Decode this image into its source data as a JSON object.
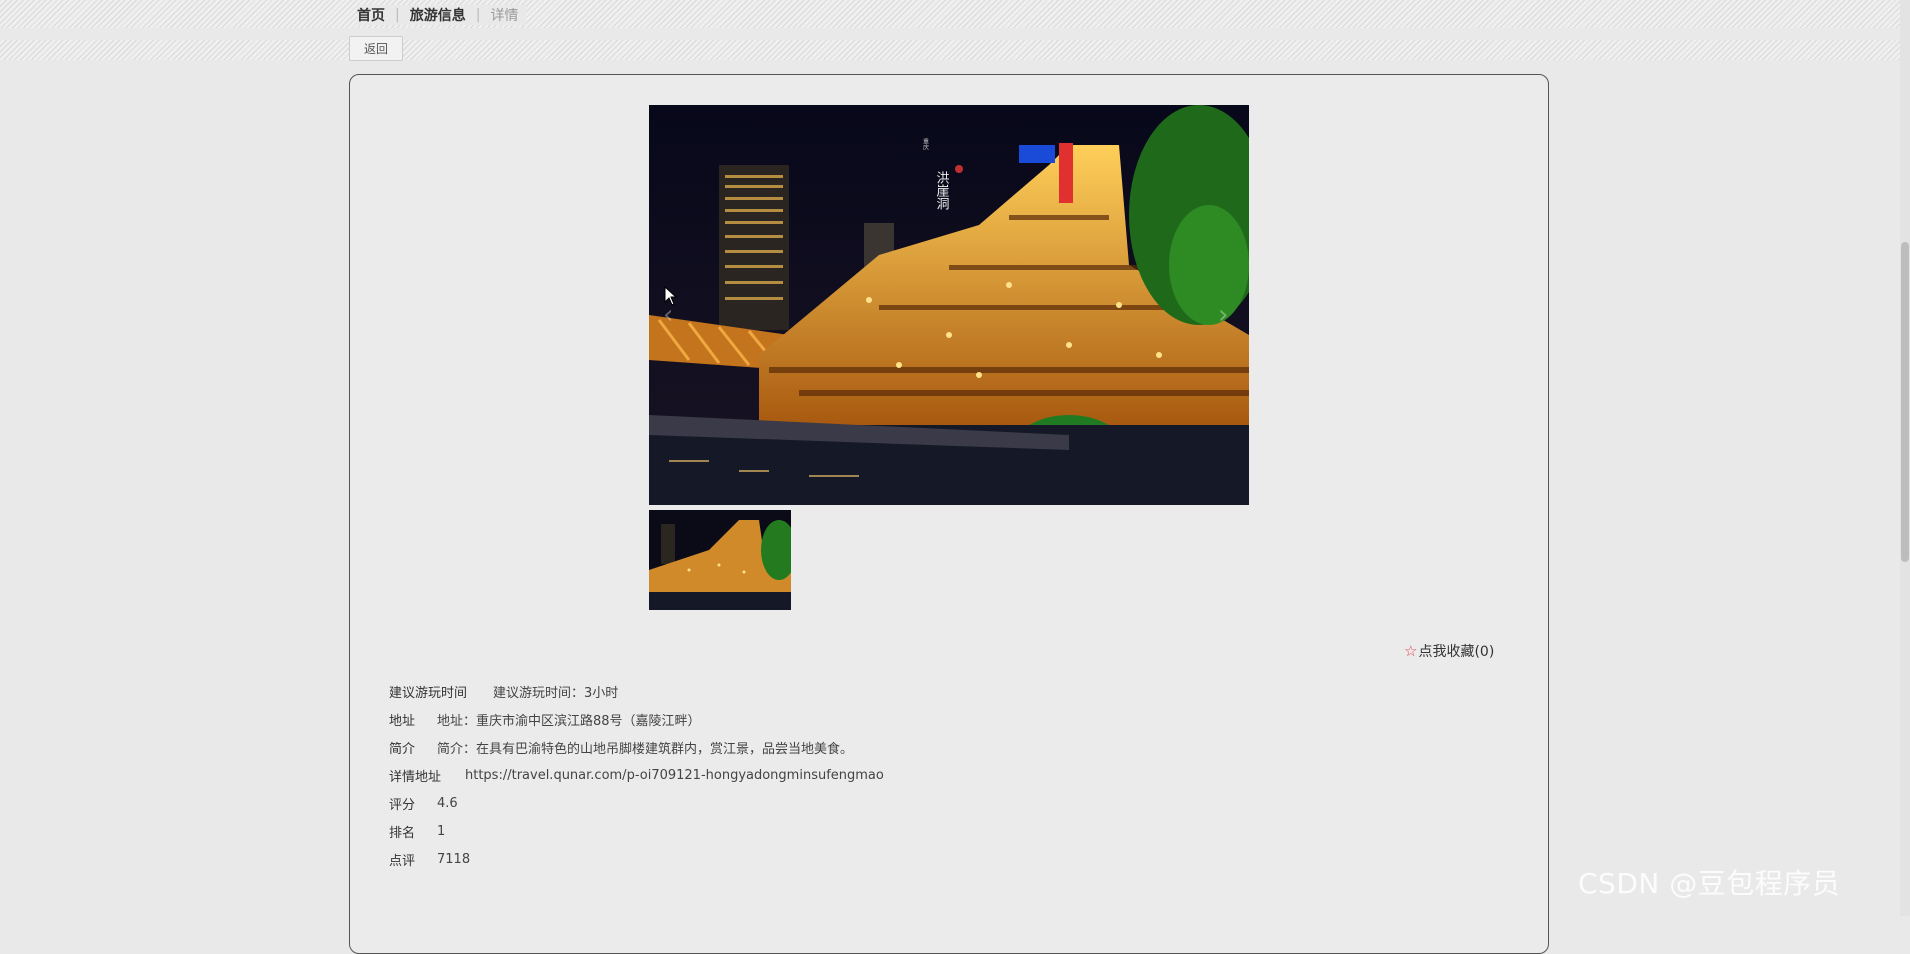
{
  "breadcrumb": {
    "home": "首页",
    "section": "旅游信息",
    "current": "详情"
  },
  "back_label": "返回",
  "photo": {
    "sign_title": "洪崖洞",
    "sign_subtitle": "重庆"
  },
  "favorite": {
    "label": "点我收藏(0)",
    "icon": "star-icon"
  },
  "details": [
    {
      "label": "建议游玩时间",
      "value": "建议游玩时间：3小时"
    },
    {
      "label": "地址",
      "value": "地址：重庆市渝中区滨江路88号（嘉陵江畔）"
    },
    {
      "label": "简介",
      "value": "简介：在具有巴渝特色的山地吊脚楼建筑群内，赏江景，品尝当地美食。"
    },
    {
      "label": "详情地址",
      "value": "https://travel.qunar.com/p-oi709121-hongyadongminsufengmao"
    },
    {
      "label": "评分",
      "value": "4.6"
    },
    {
      "label": "排名",
      "value": "1"
    },
    {
      "label": "点评",
      "value": "7118"
    }
  ],
  "watermark": "CSDN @豆包程序员",
  "colors": {
    "background": "#e9e9e9",
    "card_border": "#555555",
    "star": "#e0454b"
  }
}
